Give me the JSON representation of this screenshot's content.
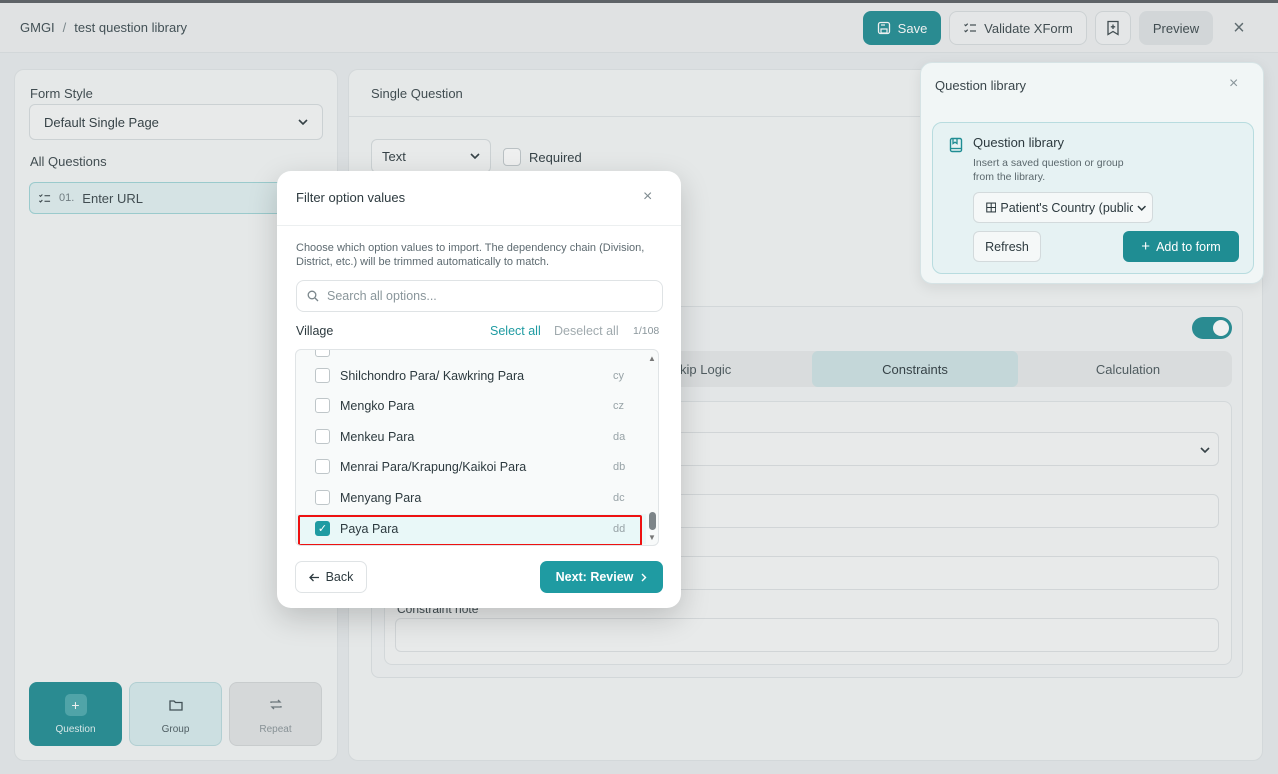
{
  "header": {
    "breadcrumb_root": "GMGI",
    "breadcrumb_sep": "/",
    "breadcrumb_page": "test question library",
    "save_label": "Save",
    "validate_label": "Validate XForm",
    "preview_label": "Preview",
    "close_glyph": "×"
  },
  "left_panel": {
    "form_style_label": "Form Style",
    "form_style_value": "Default Single Page",
    "all_questions_label": "All Questions",
    "question_number": "01.",
    "question_label": "Enter URL",
    "tiles": [
      {
        "label": "Question",
        "icon": "plus-icon"
      },
      {
        "label": "Group",
        "icon": "folder-icon"
      },
      {
        "label": "Repeat",
        "icon": "repeat-icon"
      }
    ]
  },
  "center_panel": {
    "title": "Single Question",
    "type_value": "Text",
    "required_label": "Required",
    "tabs": [
      "kip Logic",
      "Constraints",
      "Calculation"
    ],
    "constraint_note_label": "Constraint note"
  },
  "question_library": {
    "panel_title": "Question library",
    "card_title": "Question library",
    "card_desc": "Insert a saved question or group from the library.",
    "select_value": "Patient's Country (public)",
    "refresh_label": "Refresh",
    "add_label": "Add to form"
  },
  "modal": {
    "title": "Filter option values",
    "description": "Choose which option values to import. The dependency chain (Division, District, etc.) will be trimmed automatically to match.",
    "search_placeholder": "Search all options...",
    "list_label": "Village",
    "select_all": "Select all",
    "deselect_all": "Deselect all",
    "count": "1/108",
    "options": [
      {
        "name": "Shilchondro Para/ Kawkring Para",
        "code": "cy",
        "checked": false
      },
      {
        "name": "Mengko Para",
        "code": "cz",
        "checked": false
      },
      {
        "name": "Menkeu Para",
        "code": "da",
        "checked": false
      },
      {
        "name": "Menrai Para/Krapung/Kaikoi Para",
        "code": "db",
        "checked": false
      },
      {
        "name": "Menyang Para",
        "code": "dc",
        "checked": false
      },
      {
        "name": "Paya Para",
        "code": "dd",
        "checked": true
      }
    ],
    "back_label": "Back",
    "next_label": "Next: Review"
  },
  "colors": {
    "accent": "#1f9ba2",
    "highlight": "#ee1111"
  }
}
